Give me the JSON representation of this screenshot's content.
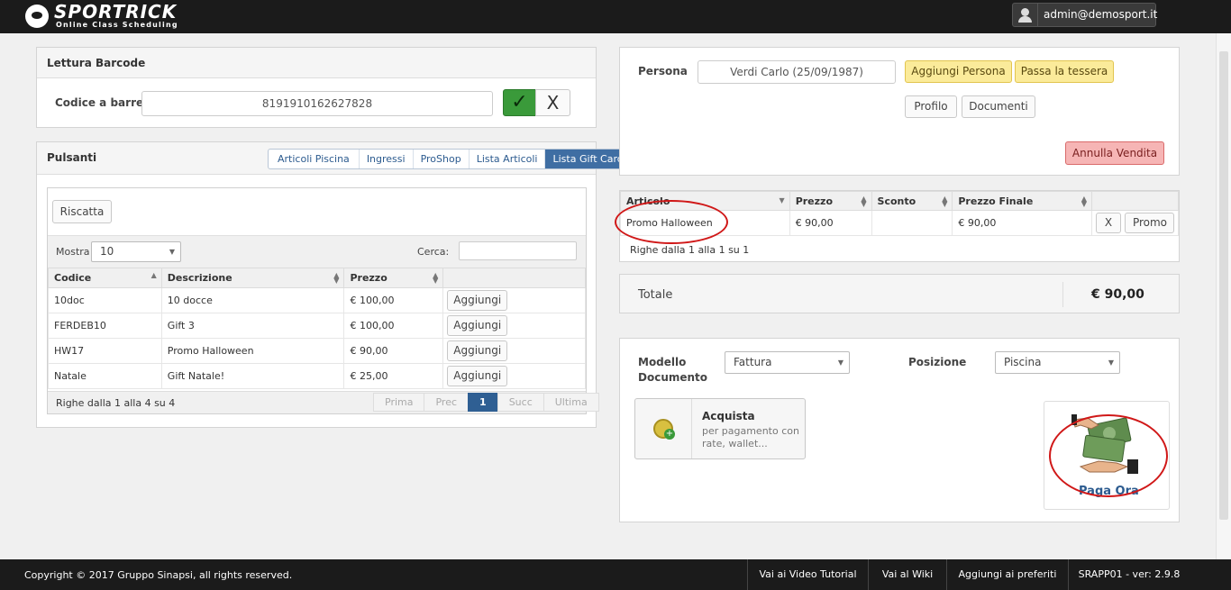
{
  "header": {
    "logo_text": "SPORTRICK",
    "logo_subtitle": "Online Class Scheduling",
    "user_email": "admin@demosport.it"
  },
  "barcode_panel": {
    "title": "Lettura Barcode",
    "label": "Codice a barre",
    "value": "8191910162627828",
    "confirm_symbol": "✓",
    "cancel_symbol": "X"
  },
  "buttons_panel": {
    "title": "Pulsanti",
    "tabs": [
      {
        "label": "Articoli Piscina"
      },
      {
        "label": "Ingressi"
      },
      {
        "label": "ProShop"
      },
      {
        "label": "Lista Articoli"
      },
      {
        "label": "Lista Gift Card"
      }
    ],
    "redeem_label": "Riscatta",
    "show_label": "Mostra",
    "show_value": "10",
    "search_label": "Cerca:",
    "search_value": "",
    "columns": [
      "Codice",
      "Descrizione",
      "Prezzo",
      ""
    ],
    "rows": [
      {
        "code": "10doc",
        "description": "10 docce",
        "price": "€ 100,00",
        "action": "Aggiungi"
      },
      {
        "code": "FERDEB10",
        "description": "Gift 3",
        "price": "€ 100,00",
        "action": "Aggiungi"
      },
      {
        "code": "HW17",
        "description": "Promo Halloween",
        "price": "€ 90,00",
        "action": "Aggiungi"
      },
      {
        "code": "Natale",
        "description": "Gift Natale!",
        "price": "€ 25,00",
        "action": "Aggiungi"
      }
    ],
    "info": "Righe dalla 1 alla 4 su 4",
    "pager": {
      "first": "Prima",
      "prev": "Prec",
      "current": "1",
      "next": "Succ",
      "last": "Ultima"
    }
  },
  "person_panel": {
    "label": "Persona",
    "value": "Verdi Carlo (25/09/1987)",
    "add_person": "Aggiungi Persona",
    "swipe_card": "Passa la tessera",
    "profile": "Profilo",
    "documents": "Documenti",
    "cancel_sale": "Annulla Vendita"
  },
  "cart": {
    "columns": [
      "Articolo",
      "Prezzo",
      "Sconto",
      "Prezzo Finale",
      ""
    ],
    "rows": [
      {
        "item": "Promo Halloween",
        "price": "€ 90,00",
        "discount": "",
        "final_price": "€ 90,00",
        "remove": "X",
        "promo": "Promo"
      }
    ],
    "info": "Righe dalla 1 alla 1 su 1"
  },
  "total": {
    "label": "Totale",
    "value": "€ 90,00"
  },
  "document_panel": {
    "model_label_1": "Modello",
    "model_label_2": "Documento",
    "model_value": "Fattura",
    "position_label": "Posizione",
    "position_value": "Piscina",
    "buy_title": "Acquista",
    "buy_desc_1": "per pagamento con",
    "buy_desc_2": "rate, wallet...",
    "pay_now": "Paga Ora"
  },
  "footer": {
    "copyright": "Copyright © 2017 Gruppo Sinapsi, all rights reserved.",
    "video_tutorial": "Vai ai Video Tutorial",
    "wiki": "Vai al Wiki",
    "favorites": "Aggiungi ai preferiti",
    "version": "SRAPP01 - ver: 2.9.8"
  },
  "colors": {
    "topbar": "#1b1b1b",
    "active_tab": "#3f6ea3",
    "confirm_green": "#3a9a3a",
    "highlight_yellow": "#fbeb9a",
    "cancel_red": "#f6b5b5",
    "annotation_red": "#d01818"
  }
}
